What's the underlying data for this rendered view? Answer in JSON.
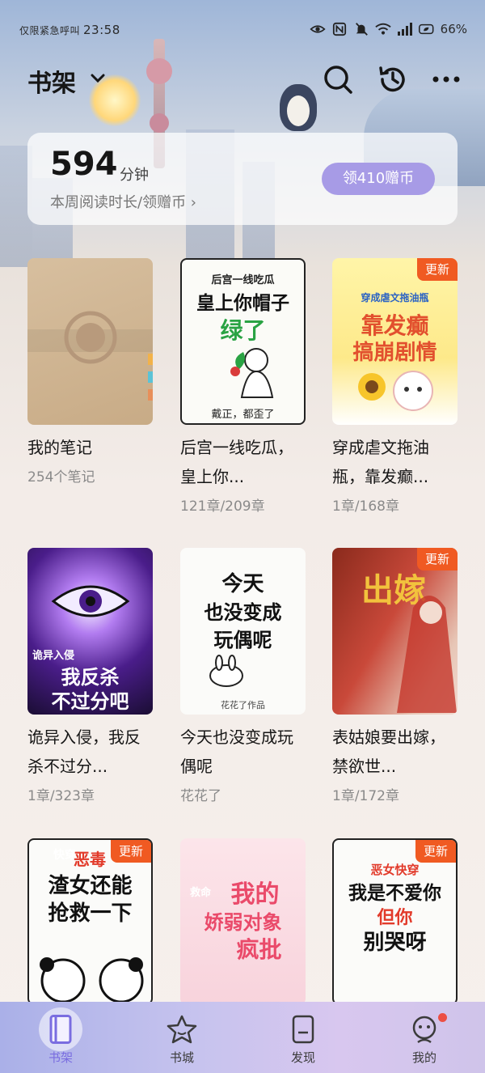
{
  "status_bar": {
    "left_text": "仅限紧急呼叫",
    "time": "23:58",
    "battery": "66%"
  },
  "header": {
    "title": "书架"
  },
  "reading_card": {
    "minutes": "594",
    "unit": "分钟",
    "subtitle": "本周阅读时长/领赠币 ›",
    "coin_button": "领410赠币"
  },
  "items": [
    {
      "title": "我的笔记",
      "meta": "254个笔记",
      "badge": "",
      "cover_text": []
    },
    {
      "title": "后宫一线吃瓜，皇上你...",
      "meta": "121章/209章",
      "badge": "",
      "cover_text": [
        "后宫一线吃瓜",
        "皇上你帽子",
        "绿了",
        "戴正，都歪了"
      ]
    },
    {
      "title": "穿成虐文拖油瓶，靠发癫...",
      "meta": "1章/168章",
      "badge": "更新",
      "cover_text": [
        "穿成虐文拖油瓶",
        "靠发癫",
        "搞崩剧情"
      ]
    },
    {
      "title": "诡异入侵，我反杀不过分...",
      "meta": "1章/323章",
      "badge": "",
      "cover_text": [
        "诡异入侵",
        "我反杀",
        "不过分吧"
      ]
    },
    {
      "title": "今天也没变成玩偶呢",
      "meta": "花花了",
      "badge": "",
      "cover_text": [
        "今天",
        "也没变成",
        "玩偶呢",
        "花花了作品"
      ]
    },
    {
      "title": "表姑娘要出嫁，禁欲世...",
      "meta": "1章/172章",
      "badge": "更新",
      "cover_text": [
        "出嫁"
      ]
    },
    {
      "title": "",
      "meta": "",
      "badge": "更新",
      "cover_text": [
        "快穿",
        "恶毒",
        "渣女还能",
        "抢救一下"
      ]
    },
    {
      "title": "",
      "meta": "",
      "badge": "",
      "cover_text": [
        "救命",
        "我的",
        "娇弱对象",
        "疯批"
      ]
    },
    {
      "title": "",
      "meta": "",
      "badge": "更新",
      "cover_text": [
        "恶女快穿",
        "我是不爱你",
        "但你",
        "别哭呀"
      ]
    }
  ],
  "nav": [
    {
      "label": "书架",
      "active": true
    },
    {
      "label": "书城",
      "active": false
    },
    {
      "label": "发现",
      "active": false
    },
    {
      "label": "我的",
      "active": false
    }
  ],
  "colors": {
    "accent": "#a79be6",
    "badge": "#f05a22",
    "active_nav": "#7a6de0"
  }
}
